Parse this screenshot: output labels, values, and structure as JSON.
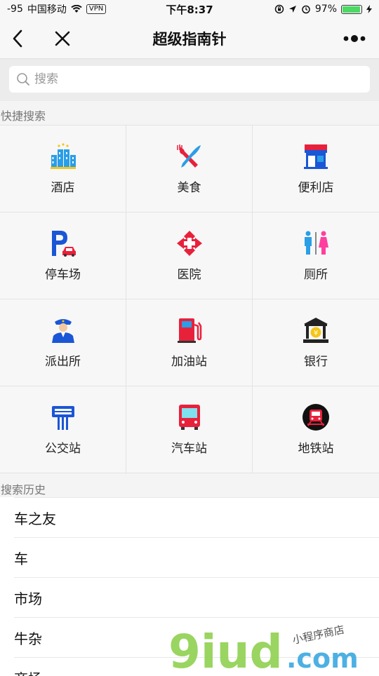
{
  "status_bar": {
    "signal": "-95",
    "carrier": "中国移动",
    "vpn": "VPN",
    "time": "下午8:37",
    "battery": "97%"
  },
  "nav": {
    "title": "超级指南针"
  },
  "search": {
    "placeholder": "搜索"
  },
  "quick_search": {
    "label": "快捷搜索",
    "items": [
      {
        "label": "酒店",
        "icon": "hotel-icon"
      },
      {
        "label": "美食",
        "icon": "food-icon"
      },
      {
        "label": "便利店",
        "icon": "store-icon"
      },
      {
        "label": "停车场",
        "icon": "parking-icon"
      },
      {
        "label": "医院",
        "icon": "hospital-icon"
      },
      {
        "label": "厕所",
        "icon": "toilet-icon"
      },
      {
        "label": "派出所",
        "icon": "police-icon"
      },
      {
        "label": "加油站",
        "icon": "gas-station-icon"
      },
      {
        "label": "银行",
        "icon": "bank-icon"
      },
      {
        "label": "公交站",
        "icon": "bus-stop-icon"
      },
      {
        "label": "汽车站",
        "icon": "bus-icon"
      },
      {
        "label": "地铁站",
        "icon": "subway-icon"
      }
    ]
  },
  "history": {
    "label": "搜索历史",
    "items": [
      "车之友",
      "车",
      "市场",
      "牛杂",
      "商场"
    ]
  },
  "watermark": {
    "brand": "9iud",
    "suffix": ".com",
    "tagline": "小程序商店"
  },
  "colors": {
    "accent_blue": "#1a56d6",
    "accent_red": "#e8213b",
    "battery_green": "#4cd964",
    "watermark_green": "#8fd14f",
    "watermark_blue": "#3aa8e0"
  }
}
